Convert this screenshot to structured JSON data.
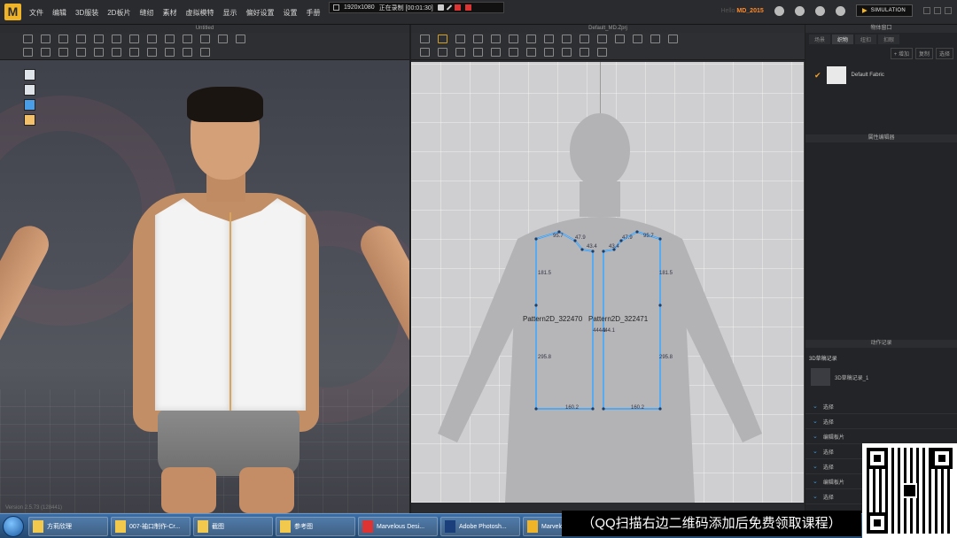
{
  "menubar": {
    "logo": "M",
    "items": [
      "文件",
      "编辑",
      "3D服装",
      "2D板片",
      "缝纫",
      "素材",
      "虚拟模特",
      "显示",
      "偏好设置",
      "设置",
      "手册"
    ],
    "recorder": {
      "resolution": "1920x1080",
      "status": "正在录制 [00:01:30]"
    },
    "version_prefix": "Hello",
    "version": "MD_2015",
    "simulation_label": "SIMULATION"
  },
  "view3d": {
    "title": "Untitled",
    "footer": "Version 2.5.73    (128441)"
  },
  "view2d": {
    "title": "Default_MD.Zprj",
    "pattern_left": {
      "name": "Pattern2D_322470",
      "labels": {
        "top": "95.7",
        "shoulder": "47.9",
        "neck": "43.4",
        "side_upper": "181.5",
        "side_lower": "295.8",
        "bottom": "160.2",
        "center": "444.1"
      }
    },
    "pattern_right": {
      "name": "Pattern2D_322471",
      "labels": {
        "top": "95.7",
        "shoulder": "47.9",
        "neck": "43.4",
        "side_upper": "181.5",
        "side_lower": "295.8",
        "bottom": "160.2",
        "center": "444.1"
      }
    }
  },
  "right_panel": {
    "object_title": "物体窗口",
    "tabs": [
      "场景",
      "织物",
      "纽扣",
      "扣眼"
    ],
    "active_tab": "织物",
    "buttons": [
      "+ 增加",
      "复制",
      "选择"
    ],
    "fabric": {
      "name": "Default Fabric",
      "color": "#e9e9e9"
    },
    "property_title": "属性编辑器",
    "history_title": "动作记录",
    "history_sub": "3D草稿记录",
    "history_thumb_label": "3D草稿记录_1",
    "history_items": [
      "选择",
      "选择",
      "编辑板片",
      "选择",
      "选择",
      "编辑板片",
      "选择"
    ]
  },
  "taskbar": {
    "items": [
      {
        "label": "方莉欣理",
        "icon": "folder-icon",
        "color": "#f2c94c"
      },
      {
        "label": "007-袖口制作-Cr...",
        "icon": "folder-icon",
        "color": "#f2c94c"
      },
      {
        "label": "截图",
        "icon": "folder-icon",
        "color": "#f2c94c"
      },
      {
        "label": "参考图",
        "icon": "folder-icon",
        "color": "#f2c94c"
      },
      {
        "label": "Marvelous Desi...",
        "icon": "pdf-icon",
        "color": "#d33"
      },
      {
        "label": "Adobe Photosh...",
        "icon": "photoshop-icon",
        "color": "#1b3f7a"
      },
      {
        "label": "Marvelous...",
        "icon": "md-icon",
        "color": "#f0b429"
      }
    ]
  },
  "banner": {
    "text": "（QQ扫描右边二维码添加后免费领取课程）"
  },
  "colors": {
    "accent": "#f0b429",
    "pattern_line": "#3b9cf0",
    "canvas": "#cfcfd1"
  }
}
